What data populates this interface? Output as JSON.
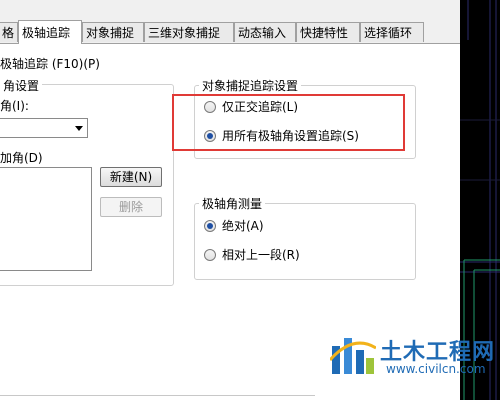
{
  "tabs": [
    {
      "label": "格"
    },
    {
      "label": "极轴追踪"
    },
    {
      "label": "对象捕捉"
    },
    {
      "label": "三维对象捕捉"
    },
    {
      "label": "动态输入"
    },
    {
      "label": "快捷特性"
    },
    {
      "label": "选择循环"
    }
  ],
  "active_tab": "极轴追踪",
  "polar_enable_label": "极轴追踪 (F10)(P)",
  "angle_settings": {
    "title": "角设置",
    "increment_label": "角(I):",
    "increment_value": "",
    "additional_label": "加角(D)",
    "new_button": "新建(N)",
    "delete_button": "删除"
  },
  "osnap_tracking": {
    "title": "对象捕捉追踪设置",
    "option_ortho": "仅正交追踪(L)",
    "option_polar": "用所有极轴角设置追踪(S)",
    "selected": "option_polar"
  },
  "polar_measurement": {
    "title": "极轴角测量",
    "option_absolute": "绝对(A)",
    "option_relative": "相对上一段(R)",
    "selected": "option_absolute"
  },
  "watermark": {
    "title": "土木工程网",
    "url": "www.civilcn.com"
  },
  "colors": {
    "highlight": "#e03a36",
    "radio_dot": "#1f4fa3",
    "watermark_blue": "#1f6bb5",
    "cad_background": "#000000"
  }
}
